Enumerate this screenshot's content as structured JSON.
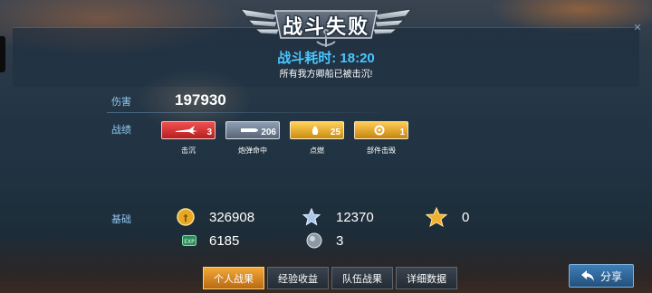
{
  "header": {
    "title": "战斗失败",
    "battle_time": "战斗耗时: 18:20",
    "result_message": "所有我方卿船已被击沉!"
  },
  "stats": {
    "damage_label": "伤害",
    "damage_value": "197930",
    "record_label": "战绩",
    "medals": [
      {
        "caption": "击沉",
        "count": "3",
        "color": "#d93030",
        "icon": "plane-icon"
      },
      {
        "caption": "炮弹命中",
        "count": "206",
        "color": "#6f7d8f",
        "icon": "shell-icon"
      },
      {
        "caption": "点燃",
        "count": "25",
        "color": "#e3a72a",
        "icon": "fire-icon"
      },
      {
        "caption": "部件击毁",
        "count": "1",
        "color": "#e0a020",
        "icon": "gear-icon"
      }
    ],
    "base_label": "基础",
    "base": {
      "coins": "326908",
      "stars": "12370",
      "rank_stars": "0",
      "experience": "6185",
      "orbs": "3"
    }
  },
  "tabs": [
    {
      "label": "个人战果",
      "active": true
    },
    {
      "label": "经验收益",
      "active": false
    },
    {
      "label": "队伍战果",
      "active": false
    },
    {
      "label": "详细数据",
      "active": false
    }
  ],
  "share_label": "分享",
  "colors": {
    "accent_blue": "#48c6ff",
    "label_blue": "#8fc8f0",
    "active_tab": "#f2a83a"
  }
}
